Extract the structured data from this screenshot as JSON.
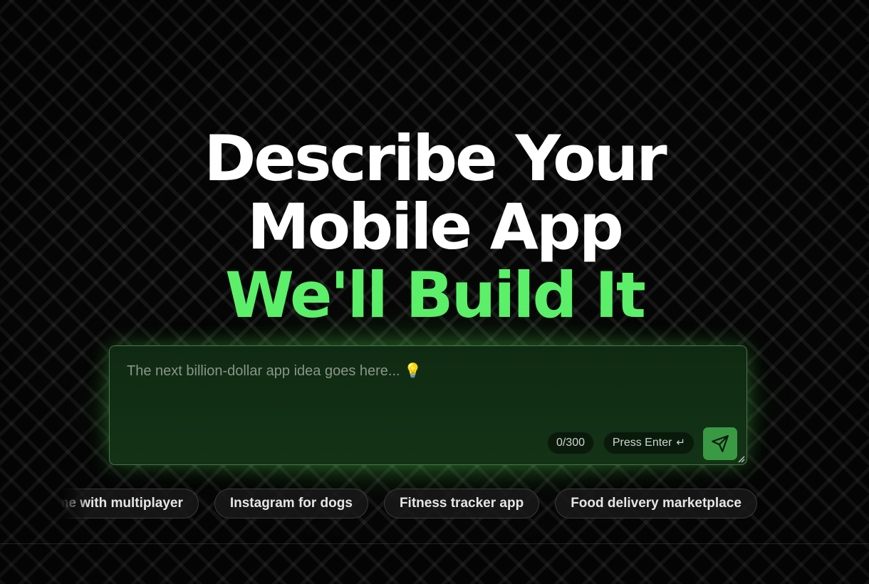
{
  "hero": {
    "line1": "Describe Your",
    "line2": "Mobile App",
    "line3": "We'll Build It"
  },
  "prompt": {
    "placeholder": "The next billion-dollar app idea goes here... 💡",
    "value": "",
    "counter": "0/300",
    "enter_hint": "Press Enter",
    "enter_glyph": "↵",
    "send_icon": "send-icon"
  },
  "suggestions": [
    "Chess game with multiplayer",
    "Instagram for dogs",
    "Fitness tracker app",
    "Food delivery marketplace"
  ],
  "colors": {
    "accent": "#5cf06a",
    "send_button": "#3a9a44",
    "background": "#050505"
  }
}
